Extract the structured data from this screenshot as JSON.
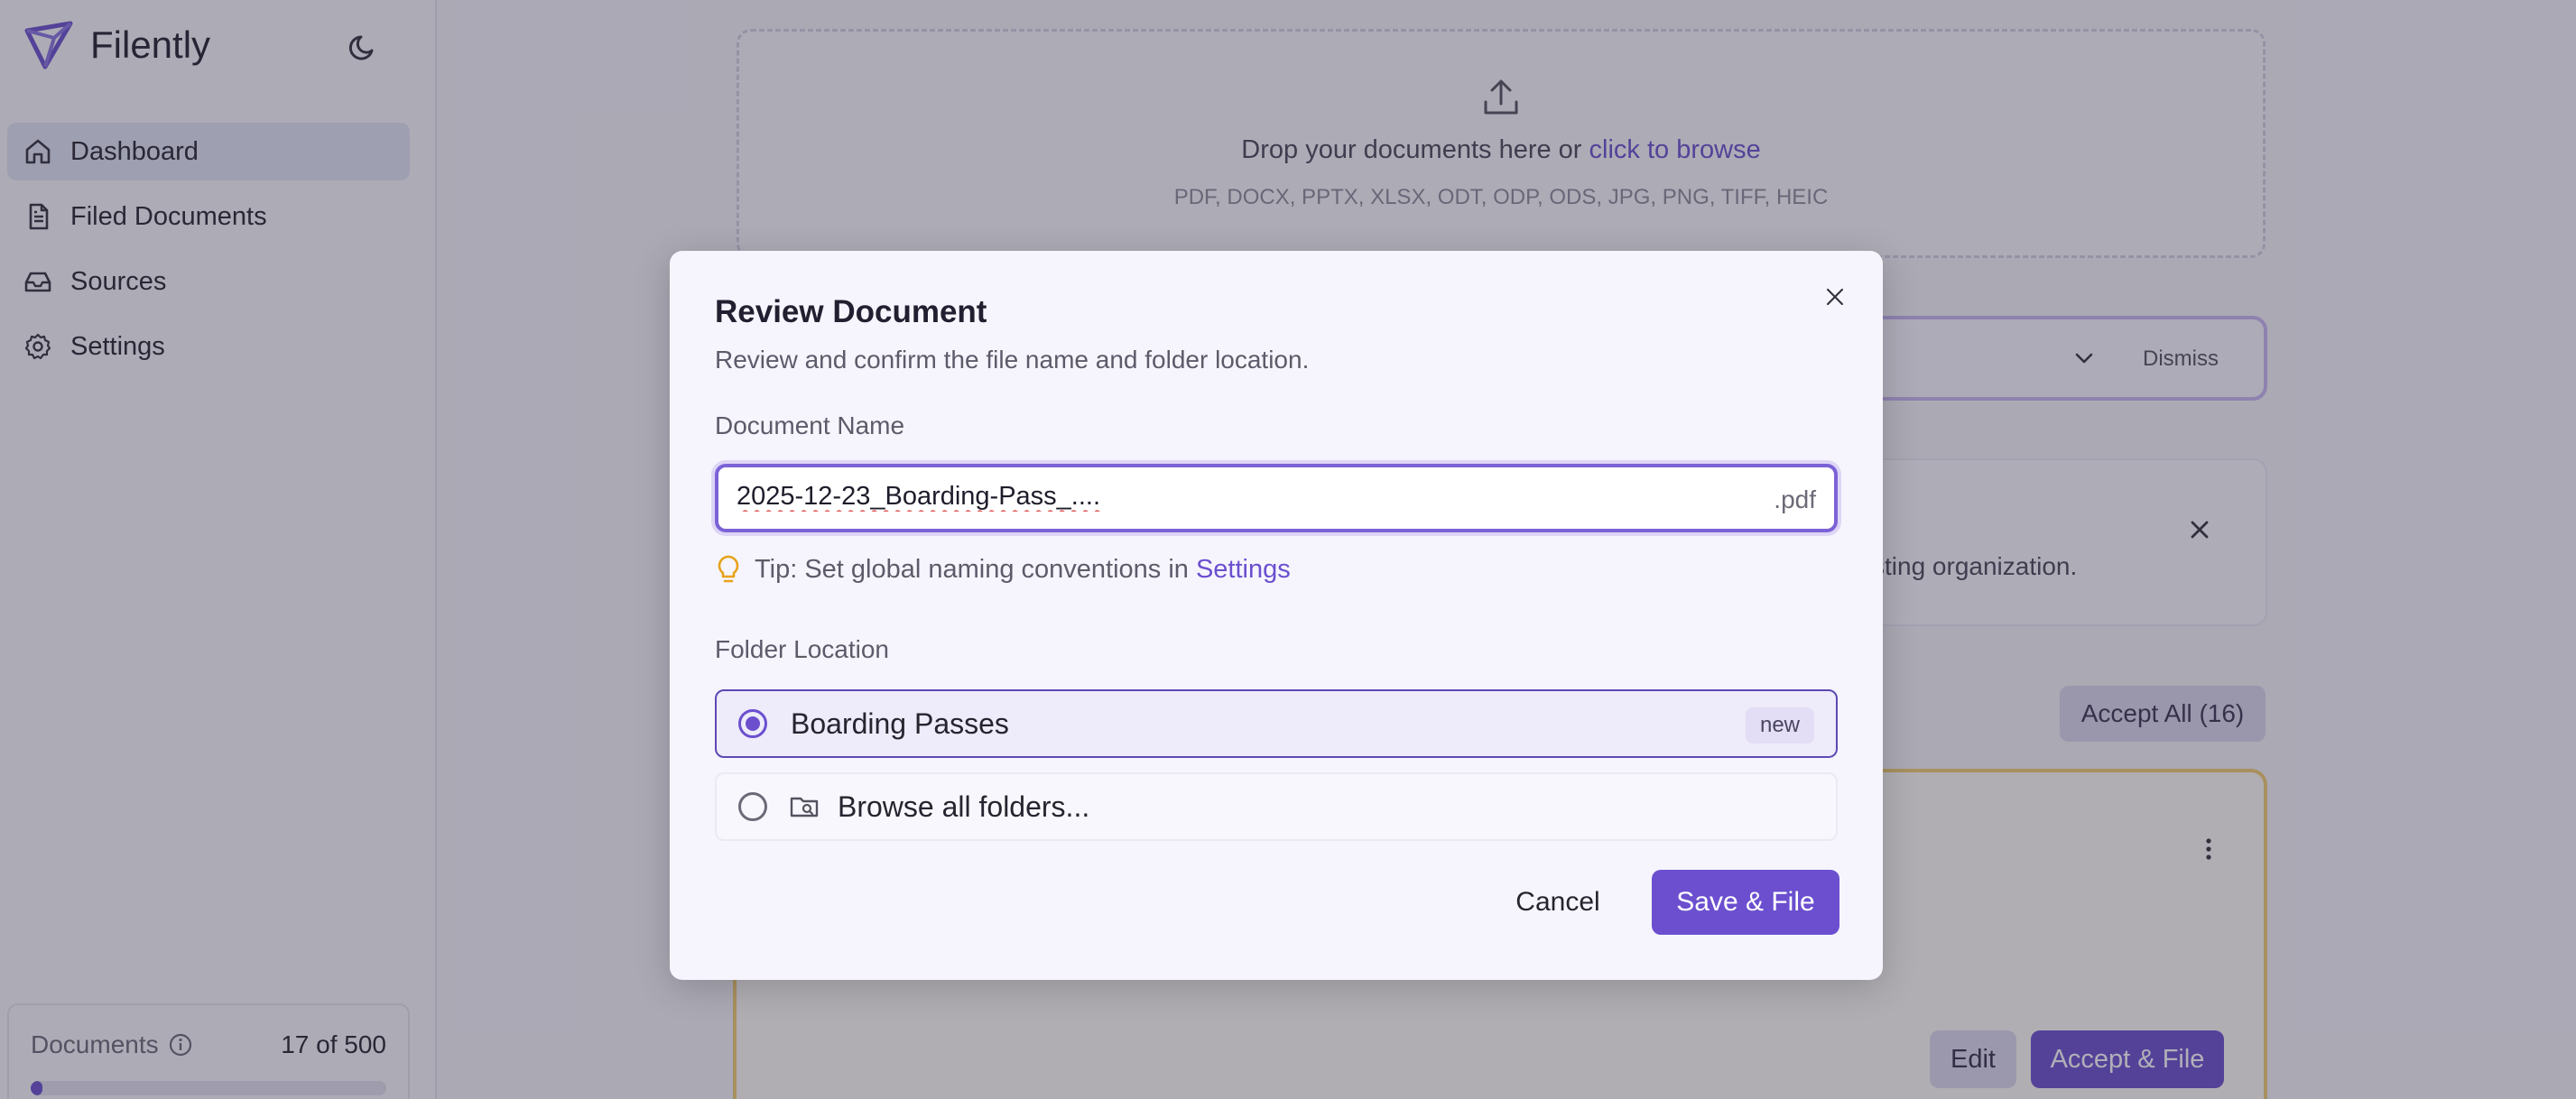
{
  "app": {
    "name": "Filently"
  },
  "sidebar": {
    "items": [
      {
        "label": "Dashboard",
        "icon": "home-icon",
        "active": true
      },
      {
        "label": "Filed Documents",
        "icon": "file-text-icon"
      },
      {
        "label": "Sources",
        "icon": "inbox-icon"
      },
      {
        "label": "Settings",
        "icon": "gear-icon"
      }
    ],
    "quota": {
      "label": "Documents",
      "count": "17 of 500",
      "used": 17,
      "total": 500
    }
  },
  "dropzone": {
    "text": "Drop your documents here or",
    "link": "click to browse",
    "formats": "PDF, DOCX, PPTX, XLSX, ODT, ODP, ODS, JPG, PNG, TIFF, HEIC"
  },
  "suggestion": {
    "dismiss_label": "Dismiss"
  },
  "info": {
    "text_fragment": "sting organization."
  },
  "queue": {
    "accept_all_label": "Accept All (16)"
  },
  "doc_card": {
    "edit_label": "Edit",
    "accept_label": "Accept & File"
  },
  "modal": {
    "title": "Review Document",
    "subtitle": "Review and confirm the file name and folder location.",
    "name_label": "Document Name",
    "name_value": "2025-12-23_Boarding-Pass_....",
    "name_extension": ".pdf",
    "tip_text": "Tip: Set global naming conventions in",
    "tip_link": "Settings",
    "folder_label": "Folder Location",
    "options": [
      {
        "label": "Boarding Passes",
        "badge": "new",
        "selected": true
      },
      {
        "label": "Browse all folders...",
        "selected": false
      }
    ],
    "cancel_label": "Cancel",
    "save_label": "Save & File"
  },
  "colors": {
    "accent": "#6b4fcf",
    "warning_border": "#f2cd72"
  }
}
